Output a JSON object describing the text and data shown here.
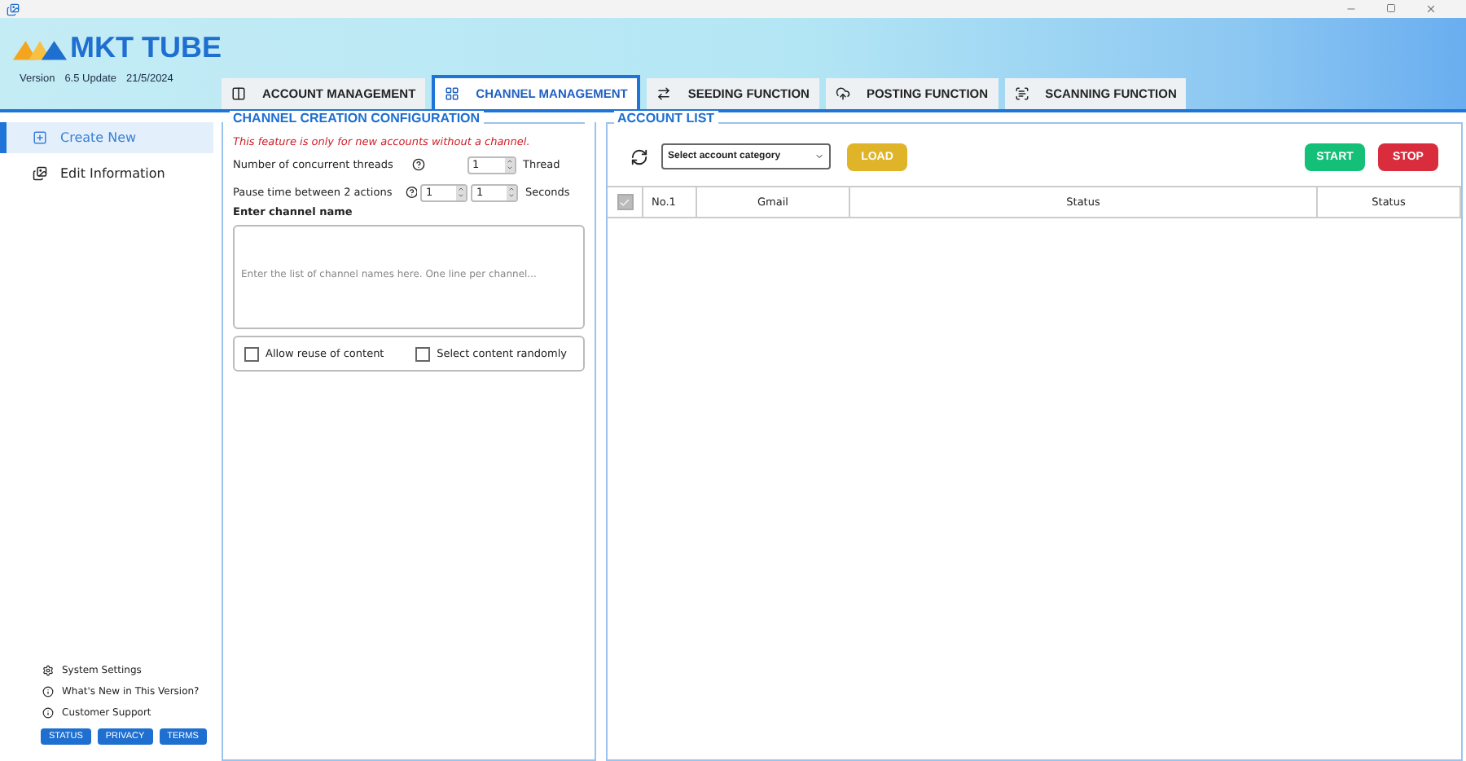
{
  "app": {
    "name": "MKT TUBE",
    "version_label": "Version",
    "version": "6.5 Update",
    "date": "21/5/2024"
  },
  "tabs": [
    {
      "label": "ACCOUNT MANAGEMENT",
      "selected": false
    },
    {
      "label": "CHANNEL MANAGEMENT",
      "selected": true
    },
    {
      "label": "SEEDING FUNCTION",
      "selected": false
    },
    {
      "label": "POSTING FUNCTION",
      "selected": false
    },
    {
      "label": "SCANNING FUNCTION",
      "selected": false
    }
  ],
  "sidebar": {
    "items": [
      {
        "label": "Create New",
        "selected": true
      },
      {
        "label": "Edit Information",
        "selected": false
      }
    ],
    "footer_links": [
      "System Settings",
      "What's New in This Version?",
      "Customer Support"
    ],
    "footer_buttons": [
      "STATUS",
      "PRIVACY",
      "TERMS"
    ]
  },
  "config": {
    "title": "CHANNEL CREATION CONFIGURATION",
    "notice": "This feature is only for new accounts without a channel.",
    "threads": {
      "label": "Number of concurrent threads",
      "value": "1",
      "unit": "Thread"
    },
    "pause": {
      "label": "Pause time between 2 actions",
      "min": "1",
      "max": "1",
      "unit": "Seconds"
    },
    "channel_names": {
      "label": "Enter channel name",
      "placeholder": "Enter the list of channel names here. One line per channel..."
    },
    "options": [
      {
        "label": "Allow reuse of content",
        "checked": false
      },
      {
        "label": "Select content randomly",
        "checked": false
      }
    ]
  },
  "account_list": {
    "title": "ACCOUNT LIST",
    "category": "Select account category",
    "buttons": [
      {
        "label": "LOAD",
        "kind": "load"
      },
      {
        "label": "START",
        "kind": "start"
      },
      {
        "label": "STOP",
        "kind": "stop"
      }
    ],
    "select_all_checked": true,
    "columns": [
      "No.1",
      "Gmail",
      "Status",
      "Status"
    ]
  }
}
